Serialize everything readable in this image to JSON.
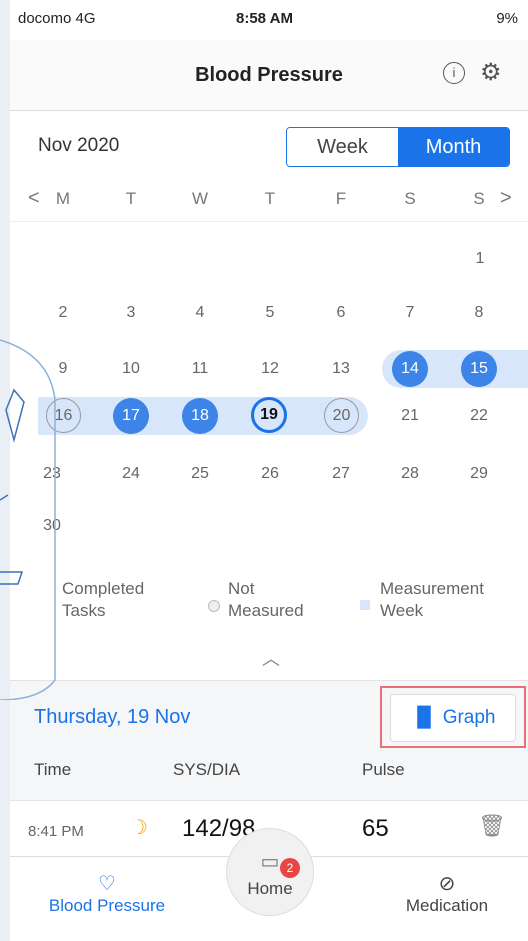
{
  "status": {
    "carrier": "docomo 4G",
    "time": "8:58 AM",
    "battery": "9%"
  },
  "nav": {
    "title": "Blood Pressure",
    "info_icon": "i",
    "settings_icon": "gear-icon"
  },
  "calendar": {
    "month_label": "Nov 2020",
    "toggle": {
      "week": "Week",
      "month": "Month",
      "selected": "Month"
    },
    "weekdays": [
      "M",
      "T",
      "W",
      "T",
      "F",
      "S",
      "S"
    ],
    "nav_prev": "<",
    "nav_next": ">",
    "days": {
      "d1": "1",
      "d2": "2",
      "d3": "3",
      "d4": "4",
      "d5": "5",
      "d6": "6",
      "d7": "7",
      "d8": "8",
      "d9": "9",
      "d10": "10",
      "d11": "11",
      "d12": "12",
      "d13": "13",
      "d14": "14",
      "d15": "15",
      "d16": "16",
      "d17": "17",
      "d18": "18",
      "d19": "19",
      "d20": "20",
      "d21": "21",
      "d22": "22",
      "d23": "23",
      "d24": "24",
      "d25": "25",
      "d26": "26",
      "d27": "27",
      "d28": "28",
      "d29": "29",
      "d30": "30"
    }
  },
  "legend": {
    "completed_line1": "Completed",
    "completed_line2": "Tasks",
    "not_line1": "Not",
    "not_line2": "Measured",
    "week_line1": "Measurement",
    "week_line2": "Week"
  },
  "day_detail": {
    "title": "Thursday, 19 Nov",
    "graph_button": "Graph",
    "headers": {
      "time": "Time",
      "sysdia": "SYS/DIA",
      "pulse": "Pulse"
    },
    "entry": {
      "time": "8:41 PM",
      "sysdia": "142/98",
      "pulse": "65"
    }
  },
  "tabs": {
    "bp": "Blood Pressure",
    "home": "Home",
    "home_badge": "2",
    "medication": "Medication"
  },
  "colors": {
    "accent": "#1a73e8",
    "completed": "#3d84e8",
    "week_band": "#d7e6fa",
    "highlight": "#e86f76"
  }
}
